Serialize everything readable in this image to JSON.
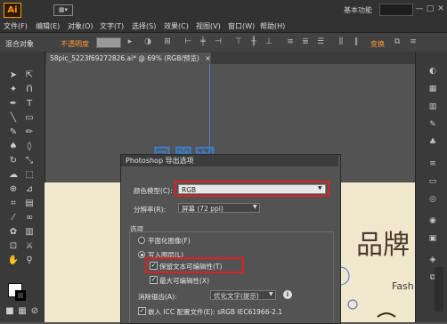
{
  "app": {
    "logo": "Ai",
    "workspace": "基本功能",
    "window_controls": [
      "—",
      "□",
      "✕"
    ]
  },
  "menus": [
    "文件(F)",
    "编辑(E)",
    "对象(O)",
    "文字(T)",
    "选择(S)",
    "效果(C)",
    "视图(V)",
    "窗口(W)",
    "帮助(H)"
  ],
  "control_bar": {
    "object_label": "混合对象",
    "opacity_label": "不透明度",
    "transform_label": "变换"
  },
  "tab": {
    "title": "58pic_5223f69272826.ai* @ 69% (RGB/预览)",
    "close": "×"
  },
  "artwork": {
    "title": "品牌",
    "subtitle": "Fash"
  },
  "dialog": {
    "title": "Photoshop 导出选项",
    "color_model_label": "颜色模型(C):",
    "color_model_value": "RGB",
    "resolution_label": "分辨率(R):",
    "resolution_value": "屏幕 (72 ppi)",
    "options_legend": "选项",
    "flatten_label": "平面化图像(F)",
    "write_layers_label": "写入图层(L)",
    "preserve_text_label": "保留文本可编辑性(T)",
    "max_edit_label": "最大可编辑性(X)",
    "antialias_label": "消除锯齿(A):",
    "antialias_value": "优化文字(提示)",
    "embed_icc_label": "嵌入 ICC 配置文件(E): sRGB IEC61966-2.1"
  }
}
